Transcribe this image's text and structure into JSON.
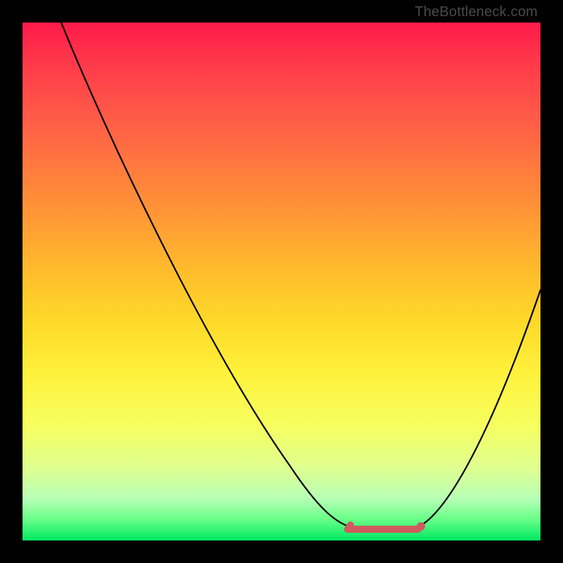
{
  "watermark": "TheBottleneck.com",
  "colors": {
    "background": "#000000",
    "curve": "#000000",
    "flat_region": "#cf5a5f"
  },
  "chart_data": {
    "type": "line",
    "title": "",
    "xlabel": "",
    "ylabel": "",
    "xlim": [
      0,
      100
    ],
    "ylim": [
      0,
      100
    ],
    "x": [
      5,
      10,
      15,
      20,
      25,
      30,
      35,
      40,
      45,
      50,
      55,
      60,
      65,
      70,
      72,
      75,
      80,
      85,
      90,
      95,
      100
    ],
    "values": [
      100,
      92,
      83,
      74,
      65,
      56,
      47,
      38,
      29,
      20,
      12,
      6,
      2,
      0,
      0,
      0,
      4,
      12,
      22,
      34,
      48
    ],
    "flat_region": {
      "x_start": 63,
      "x_end": 77,
      "value": 0
    },
    "annotations": []
  }
}
